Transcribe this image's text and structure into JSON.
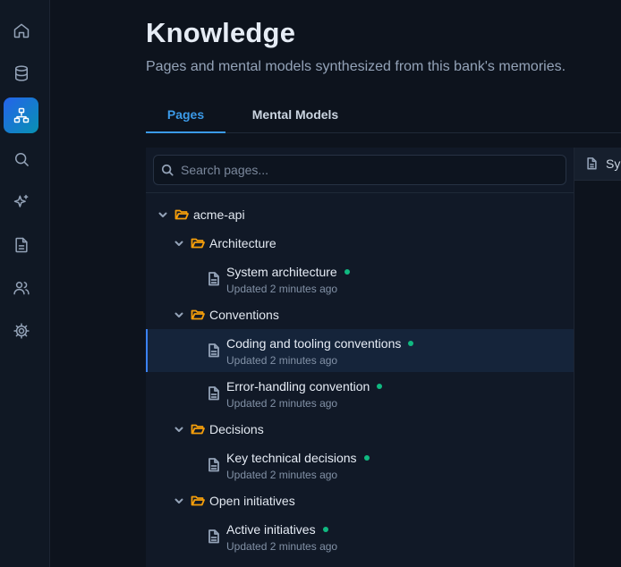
{
  "nav": {
    "items": [
      {
        "name": "home-icon"
      },
      {
        "name": "database-icon"
      },
      {
        "name": "sitemap-icon",
        "active": true
      },
      {
        "name": "search-icon"
      },
      {
        "name": "sparkles-icon"
      },
      {
        "name": "document-icon"
      },
      {
        "name": "users-icon"
      },
      {
        "name": "gear-icon"
      }
    ],
    "active_gradient": [
      "#2563eb",
      "#0891b2"
    ]
  },
  "header": {
    "title": "Knowledge",
    "subtitle": "Pages and mental models synthesized from this bank's memories."
  },
  "tabs": [
    {
      "label": "Pages",
      "active": true
    },
    {
      "label": "Mental Models",
      "active": false
    }
  ],
  "search": {
    "placeholder": "Search pages...",
    "value": ""
  },
  "tree": {
    "root": "acme-api",
    "folders": [
      {
        "label": "Architecture",
        "pages": [
          {
            "title": "System architecture",
            "updated": "Updated 2 minutes ago",
            "status": "synced"
          }
        ]
      },
      {
        "label": "Conventions",
        "pages": [
          {
            "title": "Coding and tooling conventions",
            "updated": "Updated 2 minutes ago",
            "status": "synced",
            "selected": true
          },
          {
            "title": "Error-handling convention",
            "updated": "Updated 2 minutes ago",
            "status": "synced"
          }
        ]
      },
      {
        "label": "Decisions",
        "pages": [
          {
            "title": "Key technical decisions",
            "updated": "Updated 2 minutes ago",
            "status": "synced"
          }
        ]
      },
      {
        "label": "Open initiatives",
        "pages": [
          {
            "title": "Active initiatives",
            "updated": "Updated 2 minutes ago",
            "status": "synced"
          }
        ]
      }
    ]
  },
  "preview": {
    "tab_label": "Sy"
  },
  "colors": {
    "accent": "#3b9ae8",
    "folder": "#f59e0b",
    "status_dot": "#10b981",
    "background": "#0d131d",
    "panel": "#111927",
    "selected_row": "#15243a"
  }
}
